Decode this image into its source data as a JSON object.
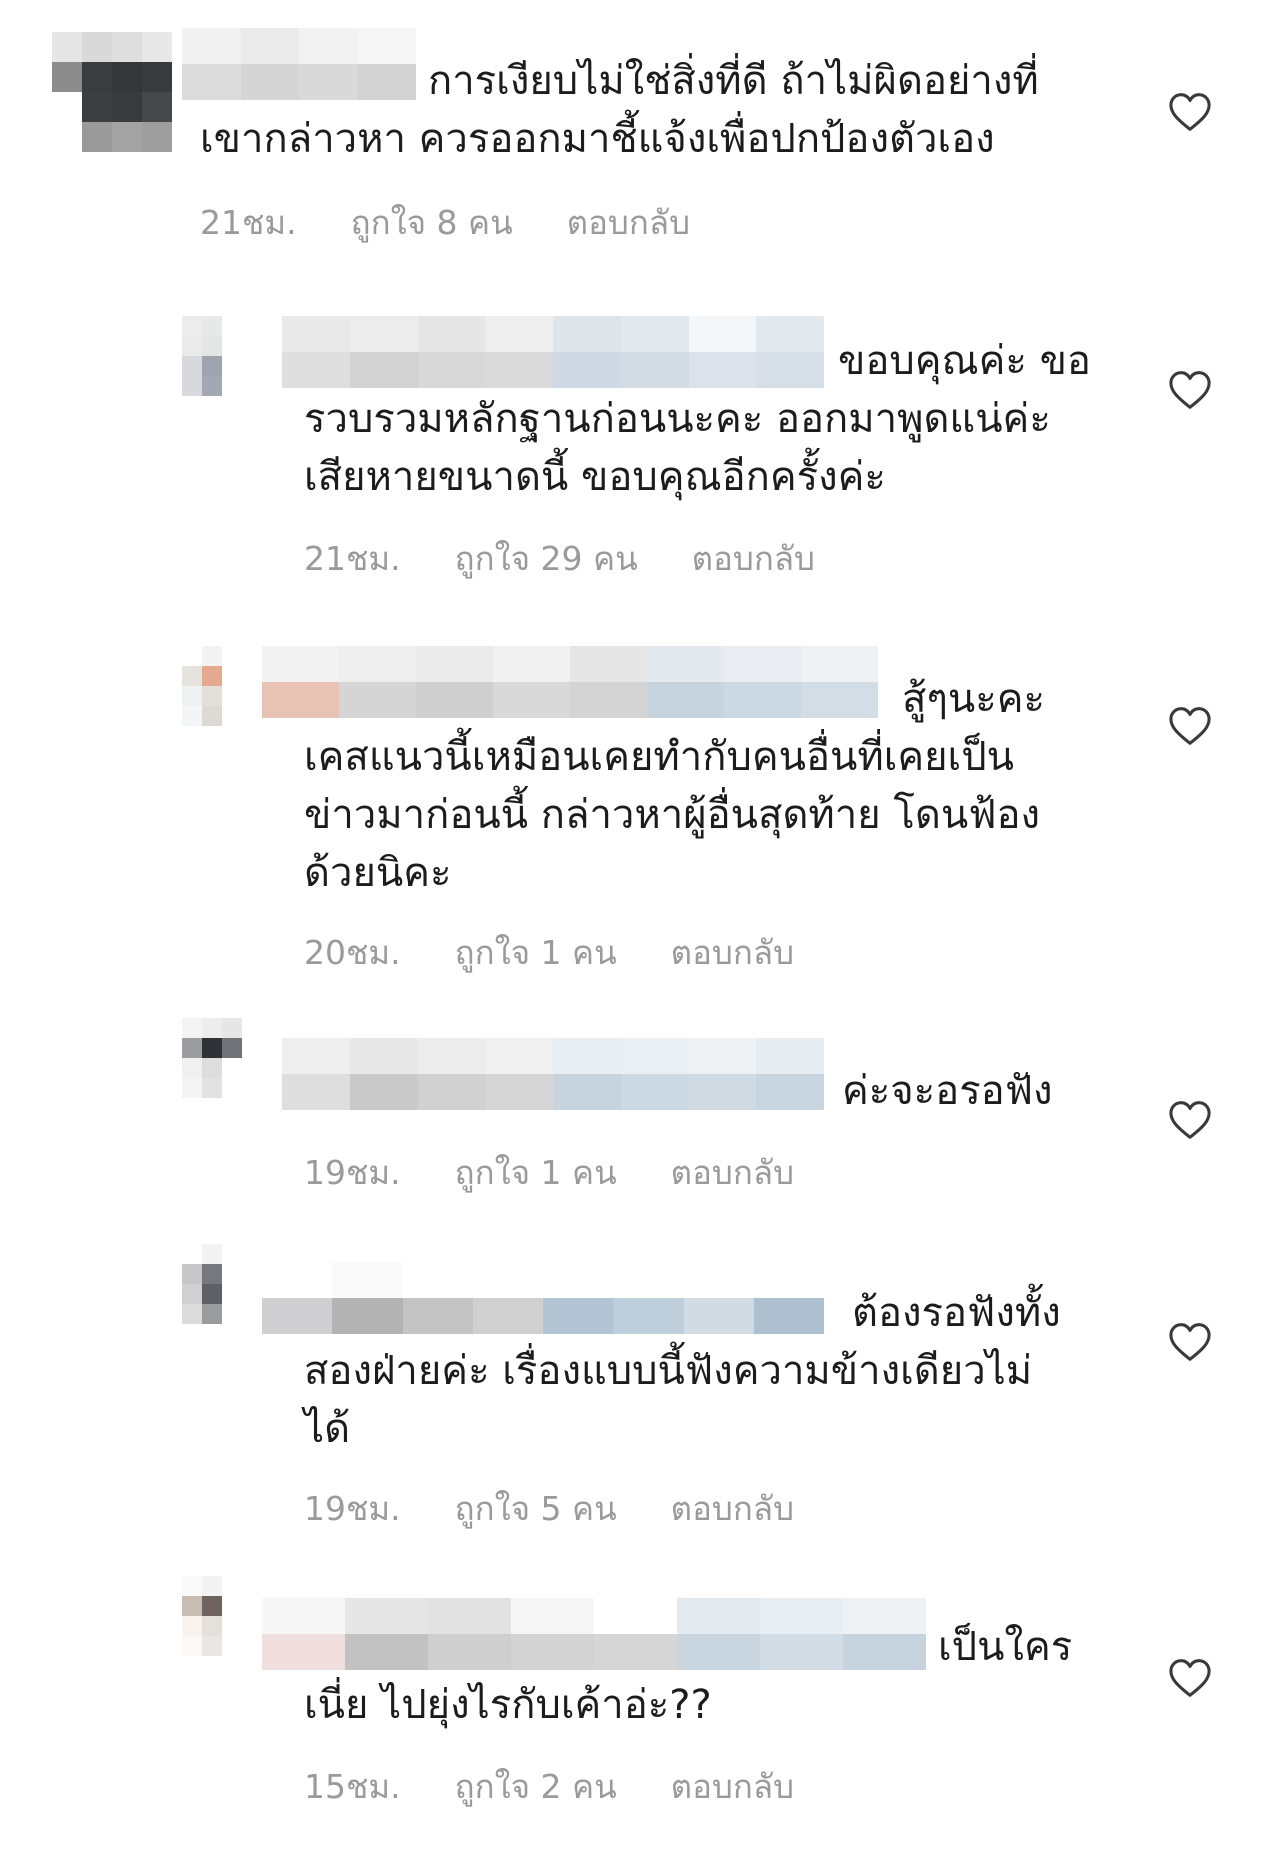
{
  "comments": [
    {
      "text": "การเงียบไม่ใช่สิ่งที่ดี ถ้าไม่ผิดอย่างที่\nเขากล่าวหา ควรออกมาชี้แจ้งเพื่อปกป้องตัวเอง",
      "time": "21ชม.",
      "likes": "ถูกใจ 8 คน",
      "reply": "ตอบกลับ"
    },
    {
      "text": "ขอบคุณค่ะ ขอ\nรวบรวมหลักฐานก่อนนะคะ ออกมาพูดแน่ค่ะ\nเสียหายขนาดนี้ ขอบคุณอีกครั้งค่ะ",
      "time": "21ชม.",
      "likes": "ถูกใจ 29 คน",
      "reply": "ตอบกลับ"
    },
    {
      "text": "สู้ๆนะคะ\nเคสแนวนี้เหมือนเคยทำกับคนอื่นที่เคยเป็น\nข่าวมาก่อนนี้ กล่าวหาผู้อื่นสุดท้าย โดนฟ้อง\nด้วยนิคะ",
      "time": "20ชม.",
      "likes": "ถูกใจ 1 คน",
      "reply": "ตอบกลับ"
    },
    {
      "text": "ค่ะจะอรอฟัง",
      "time": "19ชม.",
      "likes": "ถูกใจ 1 คน",
      "reply": "ตอบกลับ"
    },
    {
      "text": "ต้องรอฟังทั้ง\nสองฝ่ายค่ะ เรื่องแบบนี้ฟังความข้างเดียวไม่\nได้",
      "time": "19ชม.",
      "likes": "ถูกใจ 5 คน",
      "reply": "ตอบกลับ"
    },
    {
      "text": "เป็นใคร\nเนี่ย ไปยุ่งไรกับเค้าอ่ะ??",
      "time": "15ชม.",
      "likes": "ถูกใจ 2 คน",
      "reply": "ตอบกลับ"
    }
  ],
  "icons": {
    "like": "heart-outline-icon"
  },
  "colors": {
    "text": "#1c1c1c",
    "meta": "#9a9a9a",
    "heart": "#3a3a3a"
  }
}
